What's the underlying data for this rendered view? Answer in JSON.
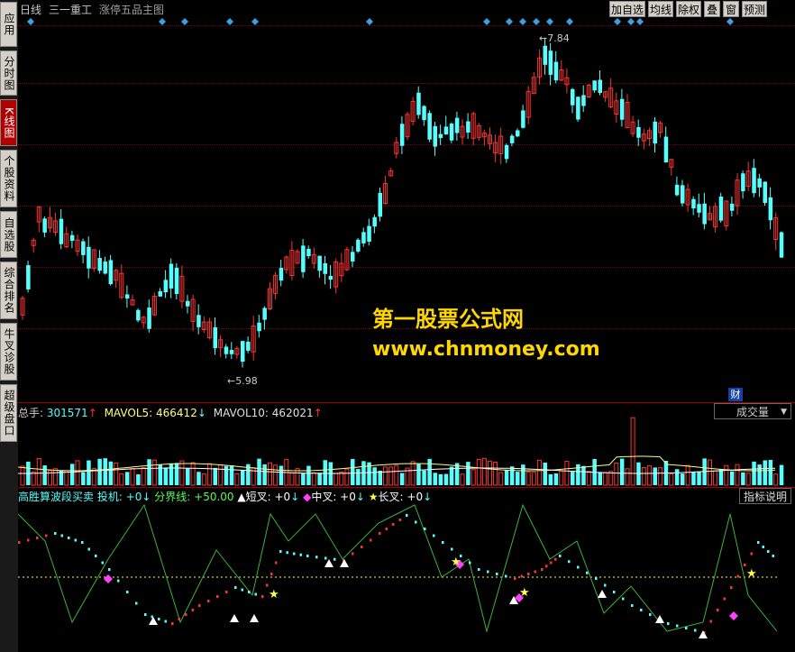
{
  "sidebar": {
    "tabs": [
      {
        "label": "应用",
        "active": false
      },
      {
        "label": "分时图",
        "active": false
      },
      {
        "label": "K线图",
        "active": true
      },
      {
        "label": "个股资料",
        "active": false
      },
      {
        "label": "自选股",
        "active": false
      },
      {
        "label": "综合排名",
        "active": false
      },
      {
        "label": "牛叉诊股",
        "active": false
      },
      {
        "label": "超级盘口",
        "active": false
      }
    ]
  },
  "header": {
    "period": "日线",
    "stock_name": "三一重工",
    "indicator_name": "涨停五品主图",
    "buttons": [
      "加自选",
      "均线",
      "除权",
      "叠",
      "窗",
      "预测"
    ]
  },
  "price_chart": {
    "high_label": "7.84",
    "low_label": "5.98",
    "watermark_line1": "第一股票公式网",
    "watermark_line2": "www.chnmoney.com",
    "cai_badge": "财",
    "colors": {
      "up": "#ff3232",
      "down": "#54ffff",
      "watermark": "#ffd700",
      "grid": "#7a0000"
    }
  },
  "volume_panel": {
    "total_label": "总手:",
    "total_value": "301571",
    "ma5_label": "MAVOL5:",
    "ma5_value": "466412",
    "ma10_label": "MAVOL10:",
    "ma10_value": "462021",
    "selector": "成交量"
  },
  "indicator_panel": {
    "name": "高胜算波段买卖",
    "investor": "投机: +0",
    "boundary": "分界线: +50.00",
    "short_cross": "短叉: +0",
    "mid_cross": "中叉: +0",
    "long_cross": "长叉: +0",
    "help_button": "指标说明"
  }
}
